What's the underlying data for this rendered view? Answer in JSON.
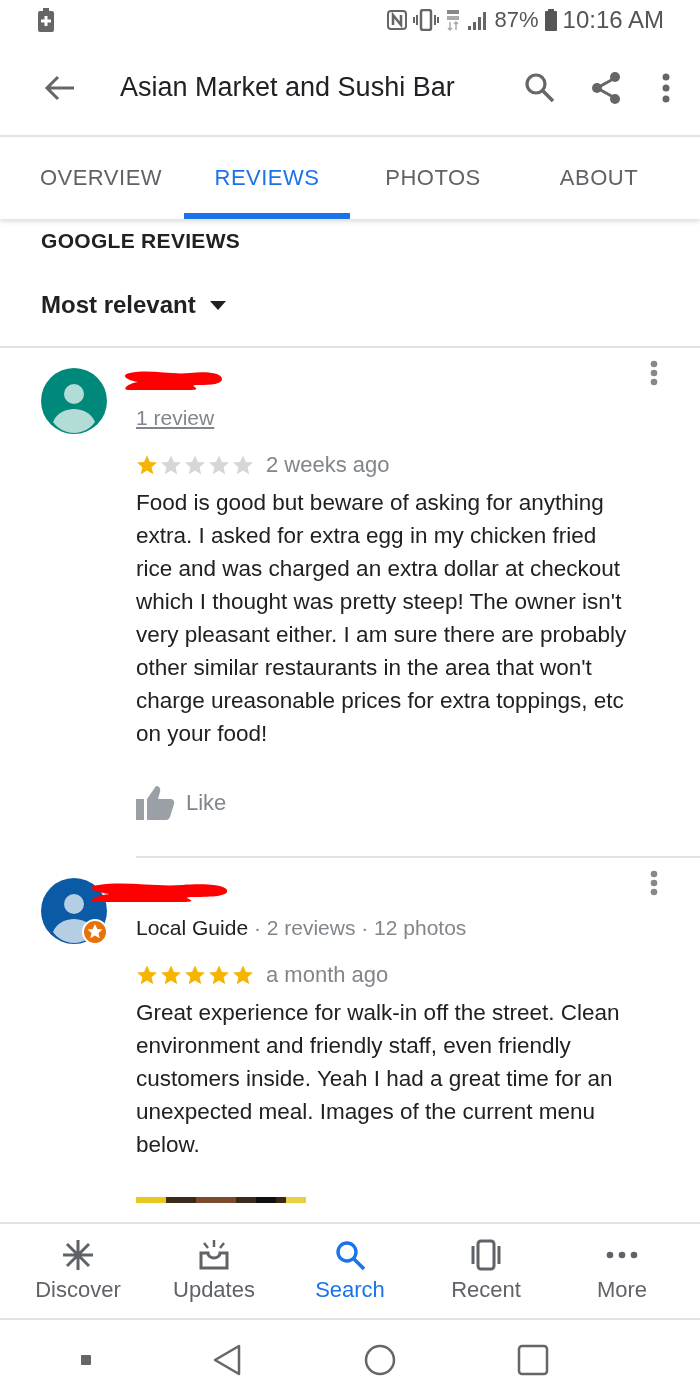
{
  "status_bar": {
    "battery": "87%",
    "time": "10:16 AM"
  },
  "header": {
    "title": "Asian Market and Sushi Bar"
  },
  "tabs": [
    {
      "label": "OVERVIEW",
      "selected": false
    },
    {
      "label": "REVIEWS",
      "selected": true
    },
    {
      "label": "PHOTOS",
      "selected": false
    },
    {
      "label": "ABOUT",
      "selected": false
    }
  ],
  "section_title": "GOOGLE REVIEWS",
  "sort": {
    "label": "Most relevant"
  },
  "reviews": [
    {
      "color": "#00897b",
      "local_guide": false,
      "meta_link": "1 review",
      "stars": 1,
      "time": "2 weeks ago",
      "text": "Food is good but beware of asking for anything extra. I asked for extra egg in my chicken fried rice and was charged an extra dollar at checkout which I thought was pretty steep! The owner isn't very pleasant either. I am sure there are probably other similar restaurants in the area that won't charge ureasonable prices for extra toppings, etc on your food!",
      "like": "Like"
    },
    {
      "color": "#0b5aa5",
      "local_guide": true,
      "guide_label": "Local Guide",
      "meta": "· 2 reviews · 12 photos",
      "stars": 5,
      "time": "a month ago",
      "text": "Great experience for walk-in off the street. Clean environment and friendly staff, even friendly customers inside.  Yeah I had a great time for an unexpected meal.  Images of the current menu below."
    }
  ],
  "bottom_nav": [
    {
      "label": "Discover",
      "selected": false
    },
    {
      "label": "Updates",
      "selected": false
    },
    {
      "label": "Search",
      "selected": true
    },
    {
      "label": "Recent",
      "selected": false
    },
    {
      "label": "More",
      "selected": false
    }
  ]
}
